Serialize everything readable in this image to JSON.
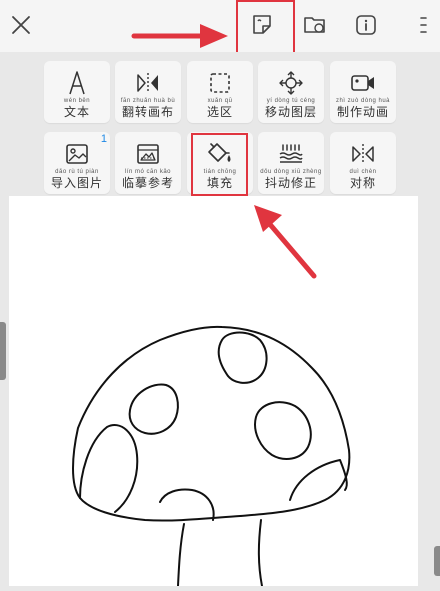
{
  "topbar": {
    "close_icon": "close-icon",
    "sticker_icon": "sticker-icon",
    "folder_icon": "folder-icon",
    "info_icon": "info-icon",
    "menu_icon": "menu-icon"
  },
  "tools": [
    {
      "label": "文本",
      "pinyin": "wén běn",
      "icon": "text-icon"
    },
    {
      "label": "翻转画布",
      "pinyin": "fān zhuǎn huà bù",
      "icon": "flip-canvas-icon"
    },
    {
      "label": "选区",
      "pinyin": "xuǎn qū",
      "icon": "selection-icon"
    },
    {
      "label": "移动图层",
      "pinyin": "yí dòng tú céng",
      "icon": "move-layer-icon"
    },
    {
      "label": "制作动画",
      "pinyin": "zhì zuò dòng huà",
      "icon": "animation-icon"
    },
    {
      "label": "导入图片",
      "pinyin": "dǎo rù tú piàn",
      "icon": "import-image-icon",
      "badge": "1"
    },
    {
      "label": "临摹参考",
      "pinyin": "lín mó cān kǎo",
      "icon": "trace-reference-icon"
    },
    {
      "label": "填充",
      "pinyin": "tián chōng",
      "icon": "fill-bucket-icon"
    },
    {
      "label": "抖动修正",
      "pinyin": "dǒu dòng xiū zhèng",
      "icon": "stabilizer-icon"
    },
    {
      "label": "对称",
      "pinyin": "duì chèn",
      "icon": "symmetry-icon"
    }
  ],
  "colors": {
    "annotation": "#e0353f",
    "badge": "#1e88e5",
    "tool_bg": "#f6f6f6",
    "panel_bg": "#e8e8e8"
  },
  "canvas": {
    "drawing": "mushroom-outline"
  }
}
